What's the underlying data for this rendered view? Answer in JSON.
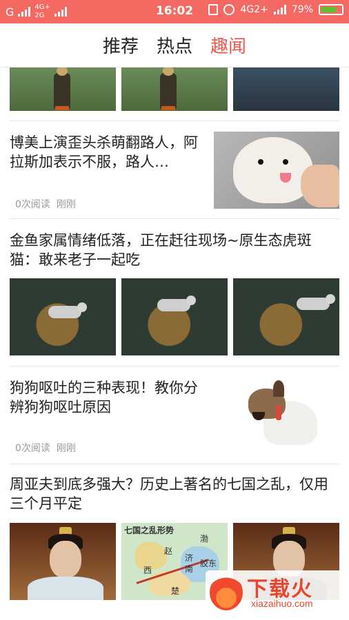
{
  "status_bar": {
    "carrier_mark": "G",
    "net_top": "4G+",
    "net_bottom": "2G",
    "time": "16:02",
    "net_right": "4G2+",
    "battery_percent": "79%",
    "battery_level": 0.79,
    "icons": [
      "signal-icon",
      "vibrate-icon",
      "alarm-icon",
      "battery-icon"
    ]
  },
  "tabs": [
    {
      "label": "推荐",
      "active": false
    },
    {
      "label": "热点",
      "active": false
    },
    {
      "label": "趣闻",
      "active": true
    }
  ],
  "accent_color": "#f2574e",
  "status_bar_color": "#f46a63",
  "articles": [
    {
      "title": "博美上演歪头杀萌翻路人，阿拉斯加表示不服，路人…",
      "reads": "0次阅读",
      "time": "刚刚"
    },
    {
      "title": "金鱼家属情绪低落，正在赶往现场~原生态虎斑猫：敢来老子一起吃"
    },
    {
      "title": "狗狗呕吐的三种表现！教你分辨狗狗呕吐原因",
      "reads": "0次阅读",
      "time": "刚刚"
    },
    {
      "title": "周亚夫到底多强大？历史上著名的七国之乱，仅用三个月平定",
      "map": {
        "heading": "七国之乱形势",
        "labels": [
          "赵",
          "济",
          "南",
          "胶东",
          "西",
          "楚",
          "渤"
        ]
      }
    }
  ],
  "watermark": {
    "brand": "下载火",
    "domain": "xiazaihuo.com"
  }
}
